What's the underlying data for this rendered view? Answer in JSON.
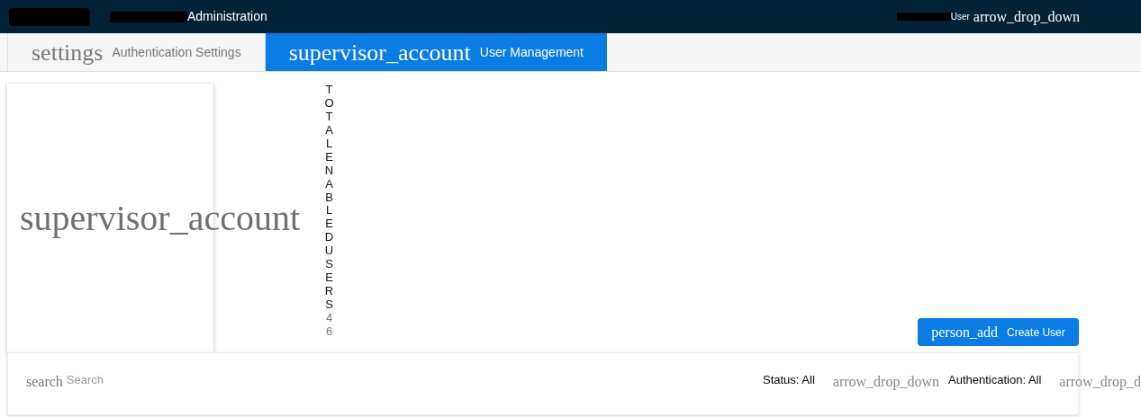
{
  "header": {
    "title": "Administration",
    "user": "User",
    "user_menu_icon": "arrow_drop_down"
  },
  "tabs": [
    {
      "icon": "settings",
      "label": "Authentication Settings",
      "selected": false
    },
    {
      "icon": "supervisor_account",
      "label": "User Management",
      "selected": true
    }
  ],
  "stat_card": {
    "icon": "supervisor_account",
    "label": "TOTALENABLEDUSERS",
    "value": "46"
  },
  "create_button": {
    "icon": "person_add",
    "label": "Create User"
  },
  "filters": {
    "search_icon": "search",
    "search_placeholder": "Search",
    "status": "Status: All",
    "status_icon": "arrow_drop_down",
    "authentication": "Authentication: All",
    "authentication_icon": "arrow_drop_d"
  }
}
